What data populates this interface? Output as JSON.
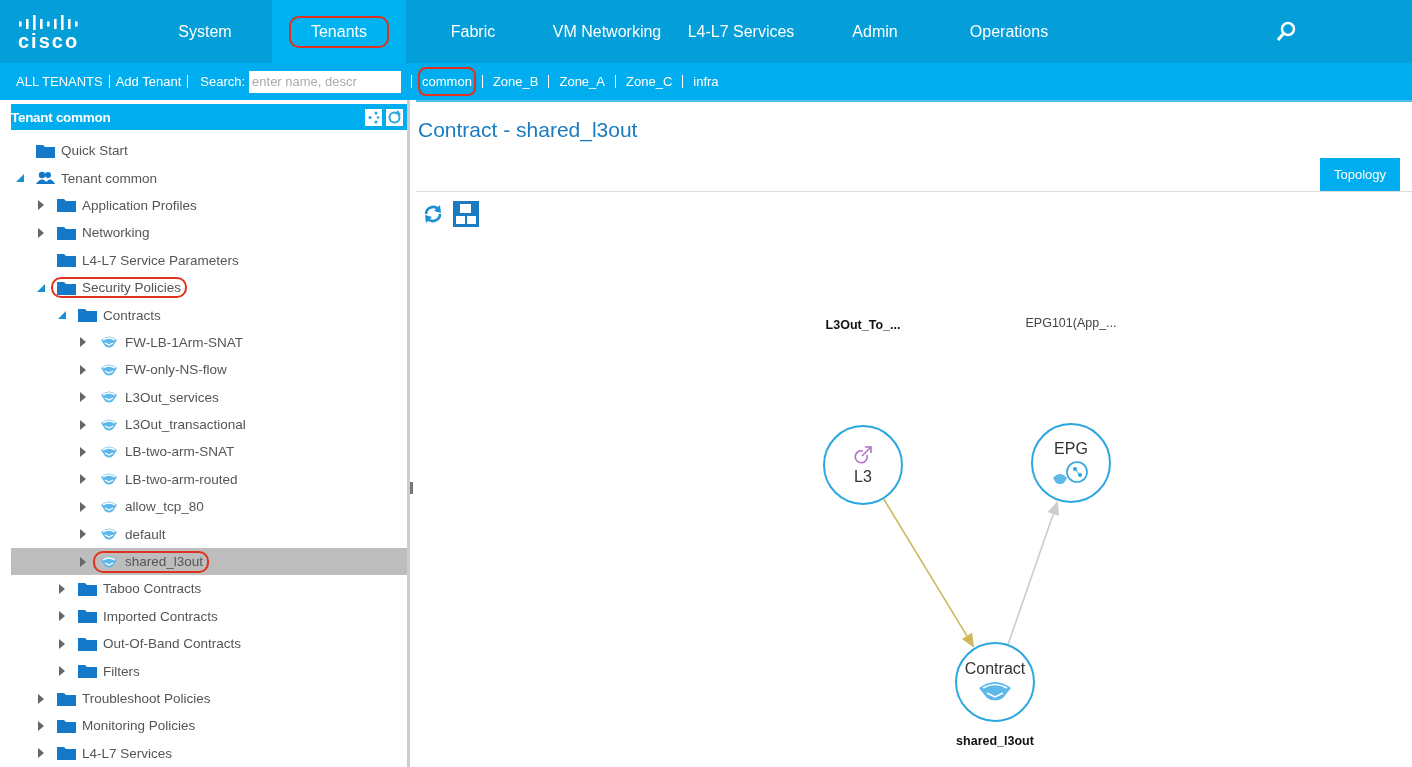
{
  "nav": {
    "logo": "cisco",
    "tabs": [
      {
        "label": "System",
        "selected": false,
        "annotated": false
      },
      {
        "label": "Tenants",
        "selected": true,
        "annotated": true
      },
      {
        "label": "Fabric",
        "selected": false,
        "annotated": false
      },
      {
        "label": "VM Networking",
        "selected": false,
        "annotated": false
      },
      {
        "label": "L4-L7 Services",
        "selected": false,
        "annotated": false
      },
      {
        "label": "Admin",
        "selected": false,
        "annotated": false
      },
      {
        "label": "Operations",
        "selected": false,
        "annotated": false
      }
    ]
  },
  "subbar": {
    "actions": [
      "ALL TENANTS",
      "Add Tenant"
    ],
    "search_label": "Search:",
    "search": {
      "placeholder": "enter name, descr"
    },
    "tenants": [
      {
        "label": "common",
        "annotated": true
      },
      {
        "label": "Zone_B",
        "annotated": false
      },
      {
        "label": "Zone_A",
        "annotated": false
      },
      {
        "label": "Zone_C",
        "annotated": false
      },
      {
        "label": "infra",
        "annotated": false
      }
    ]
  },
  "sidebar": {
    "title": "Tenant common",
    "tree": [
      {
        "label": "Quick Start",
        "kind": "folder",
        "selected": false,
        "annotated": false
      },
      {
        "label": "Tenant common",
        "kind": "tenant",
        "expanded": true,
        "selected": false,
        "annotated": false,
        "children": [
          {
            "label": "Application Profiles",
            "kind": "folder",
            "expanded": false,
            "selected": false,
            "annotated": false
          },
          {
            "label": "Networking",
            "kind": "folder",
            "expanded": false,
            "selected": false,
            "annotated": false
          },
          {
            "label": "L4-L7 Service Parameters",
            "kind": "folder",
            "selected": false,
            "annotated": false
          },
          {
            "label": "Security Policies",
            "kind": "folder",
            "expanded": true,
            "selected": false,
            "annotated": true,
            "children": [
              {
                "label": "Contracts",
                "kind": "folder",
                "expanded": true,
                "selected": false,
                "annotated": false,
                "children": [
                  {
                    "label": "FW-LB-1Arm-SNAT",
                    "kind": "contract",
                    "expanded": false,
                    "selected": false,
                    "annotated": false
                  },
                  {
                    "label": "FW-only-NS-flow",
                    "kind": "contract",
                    "expanded": false,
                    "selected": false,
                    "annotated": false
                  },
                  {
                    "label": "L3Out_services",
                    "kind": "contract",
                    "expanded": false,
                    "selected": false,
                    "annotated": false
                  },
                  {
                    "label": "L3Out_transactional",
                    "kind": "contract",
                    "expanded": false,
                    "selected": false,
                    "annotated": false
                  },
                  {
                    "label": "LB-two-arm-SNAT",
                    "kind": "contract",
                    "expanded": false,
                    "selected": false,
                    "annotated": false
                  },
                  {
                    "label": "LB-two-arm-routed",
                    "kind": "contract",
                    "expanded": false,
                    "selected": false,
                    "annotated": false
                  },
                  {
                    "label": "allow_tcp_80",
                    "kind": "contract",
                    "expanded": false,
                    "selected": false,
                    "annotated": false
                  },
                  {
                    "label": "default",
                    "kind": "contract",
                    "expanded": false,
                    "selected": false,
                    "annotated": false
                  },
                  {
                    "label": "shared_l3out",
                    "kind": "contract",
                    "expanded": false,
                    "selected": true,
                    "annotated": true
                  }
                ]
              },
              {
                "label": "Taboo Contracts",
                "kind": "folder",
                "expanded": false,
                "selected": false,
                "annotated": false
              },
              {
                "label": "Imported Contracts",
                "kind": "folder",
                "expanded": false,
                "selected": false,
                "annotated": false
              },
              {
                "label": "Out-Of-Band Contracts",
                "kind": "folder",
                "expanded": false,
                "selected": false,
                "annotated": false
              },
              {
                "label": "Filters",
                "kind": "folder",
                "expanded": false,
                "selected": false,
                "annotated": false
              }
            ]
          },
          {
            "label": "Troubleshoot Policies",
            "kind": "folder",
            "expanded": false,
            "selected": false,
            "annotated": false
          },
          {
            "label": "Monitoring Policies",
            "kind": "folder",
            "expanded": false,
            "selected": false,
            "annotated": false
          },
          {
            "label": "L4-L7 Services",
            "kind": "folder",
            "expanded": false,
            "selected": false,
            "annotated": false
          }
        ]
      }
    ]
  },
  "content": {
    "title": "Contract - shared_l3out",
    "tabs": [
      {
        "label": "Topology",
        "selected": true
      }
    ],
    "topology": {
      "nodes": [
        {
          "kind": "l3",
          "label": "L3",
          "caption": "L3Out_To_...",
          "caption_bold": true
        },
        {
          "kind": "epg",
          "label": "EPG",
          "caption": "EPG101(App_...",
          "caption_bold": false
        },
        {
          "kind": "contract",
          "label": "Contract",
          "caption": "shared_l3out",
          "caption_bold": true
        }
      ],
      "edges": [
        {
          "color": "#cdb95a"
        },
        {
          "color": "#cccccc"
        }
      ]
    }
  }
}
